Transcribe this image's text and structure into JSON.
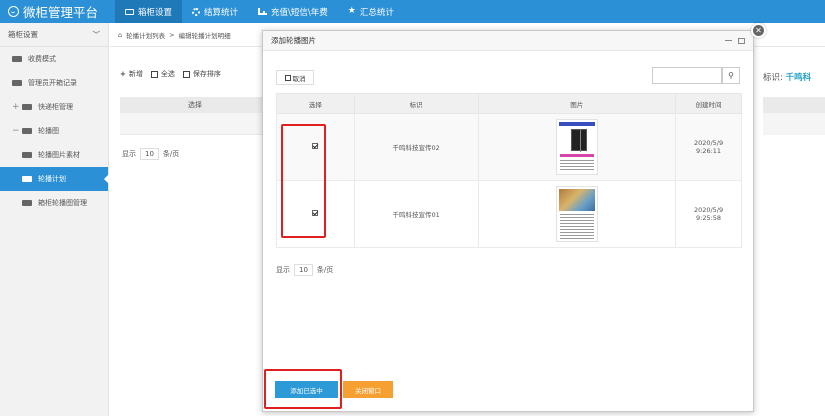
{
  "brand": {
    "title": "微柜管理平台"
  },
  "topnav": [
    {
      "label": "箱柜设置",
      "icon": "monitor-icon",
      "active": true
    },
    {
      "label": "结算统计",
      "icon": "gear-icon",
      "active": false
    },
    {
      "label": "充值\\短信\\年费",
      "icon": "chart-icon",
      "active": false
    },
    {
      "label": "汇总统计",
      "icon": "star-icon",
      "active": false
    }
  ],
  "sidebar": {
    "header": "箱柜设置",
    "items": [
      {
        "label": "收费模式"
      },
      {
        "label": "管理员开箱记录"
      },
      {
        "label": "快递柜管理",
        "sign": "+"
      },
      {
        "label": "轮播图",
        "sign": "−"
      },
      {
        "label": "轮播图片素材"
      },
      {
        "label": "轮播计划",
        "active": true
      },
      {
        "label": "箱柜轮播图管理"
      }
    ]
  },
  "breadcrumb": {
    "part1": "轮播计划列表",
    "separator": ">",
    "part2": "编辑轮播计划明细"
  },
  "toolbar": {
    "add": "新增",
    "select_all": "全选",
    "save_sort": "保存排序"
  },
  "main_table": {
    "col_select": "选择"
  },
  "main_pager": {
    "show": "显示",
    "size": "10",
    "unit": "条/页"
  },
  "right_panel": {
    "label": "标识:",
    "value": "千鸣科"
  },
  "modal": {
    "title": "添加轮播图片",
    "cancel_label": "取消",
    "columns": {
      "select": "选择",
      "identifier": "标识",
      "image": "图片",
      "created": "创建时间"
    },
    "rows": [
      {
        "identifier": "千鸣科技宣传02",
        "date": "2020/5/9",
        "time": "9:26:11",
        "checked": true
      },
      {
        "identifier": "千鸣科技宣传01",
        "date": "2020/5/9",
        "time": "9:25:58",
        "checked": true
      }
    ],
    "pager": {
      "show": "显示",
      "size": "10",
      "unit": "条/页"
    },
    "add_button": "添加已选中",
    "close_button": "关闭窗口"
  },
  "colors": {
    "primary": "#2c90d6",
    "orange": "#f5a030",
    "highlight": "#e02020"
  }
}
